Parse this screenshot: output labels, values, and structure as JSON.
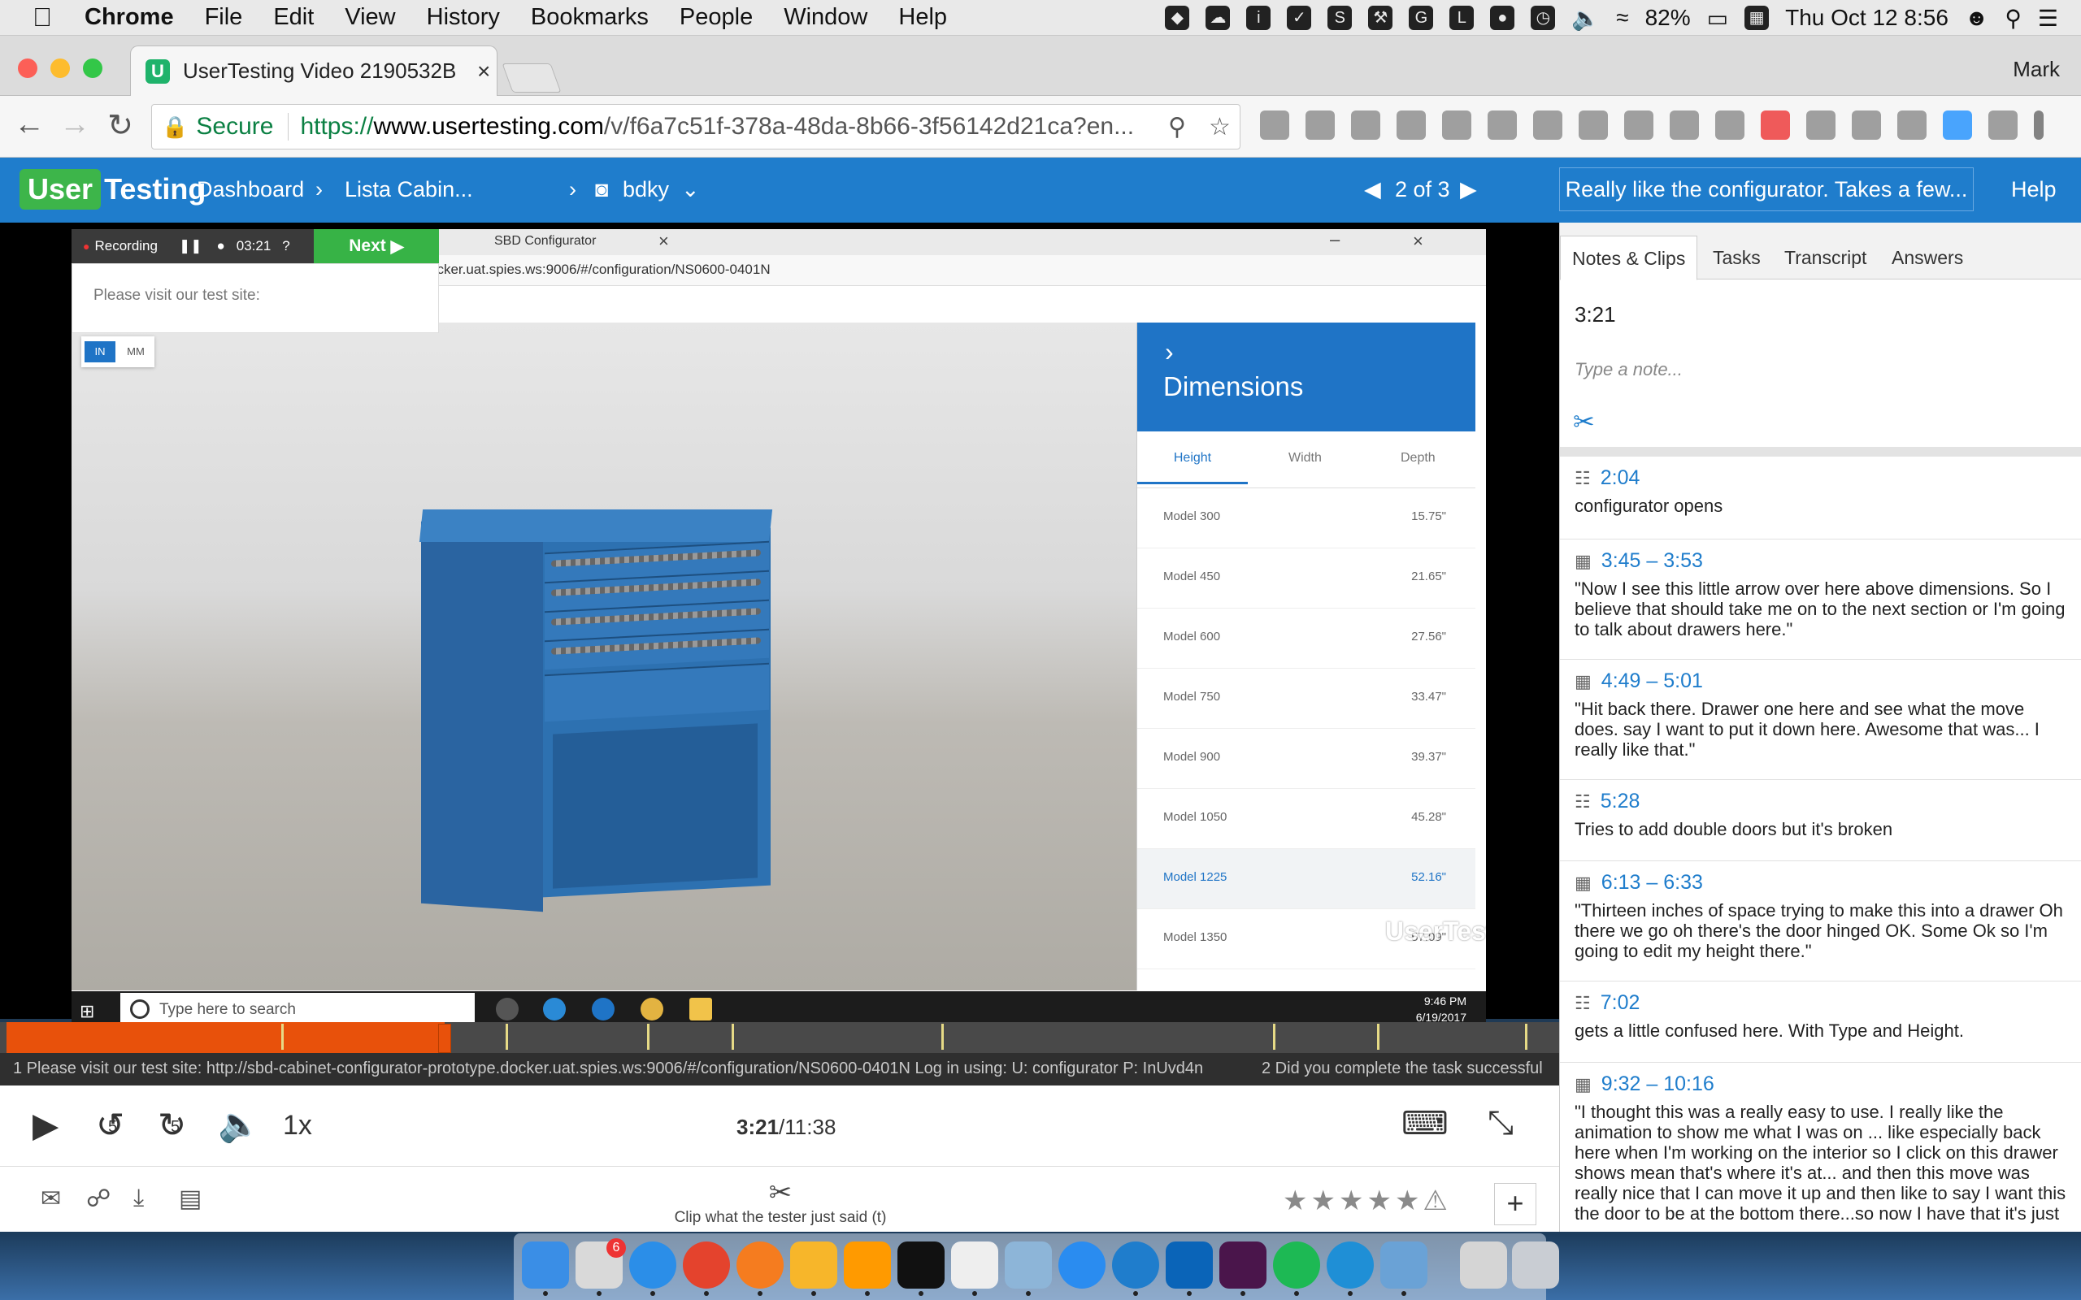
{
  "menubar": {
    "items": [
      "Chrome",
      "File",
      "Edit",
      "View",
      "History",
      "Bookmarks",
      "People",
      "Window",
      "Help"
    ],
    "battery": "82%",
    "clock": "Thu Oct 12  8:56"
  },
  "browser": {
    "tab_title": "UserTesting Video 2190532B",
    "user": "Mark",
    "secure_label": "Secure",
    "url_scheme": "https://",
    "url_host": "www.usertesting.com",
    "url_path": "/v/f6a7c51f-378a-48da-8b66-3f56142d21ca?en..."
  },
  "ut_header": {
    "logo_a": "User",
    "logo_b": "Testing",
    "dashboard": "Dashboard",
    "study": "Lista Cabin...",
    "tester": "bdky",
    "video_index": "2 of 3",
    "latest_note": "Really like the configurator. Takes a few...",
    "help": "Help"
  },
  "video": {
    "recording_label": "Recording",
    "rec_time": "03:21",
    "next_label": "Next",
    "inner_tab": "SBD Configurator",
    "inner_url": "ocker.uat.spies.ws:9006/#/configuration/NS0600-0401N",
    "visit_text": "Please visit our test site:",
    "unit_in": "IN",
    "unit_mm": "MM",
    "panel_title": "Dimensions",
    "panel_tabs": [
      "Height",
      "Width",
      "Depth"
    ],
    "models": [
      {
        "name": "Model 300",
        "value": "15.75\""
      },
      {
        "name": "Model 450",
        "value": "21.65\""
      },
      {
        "name": "Model 600",
        "value": "27.56\""
      },
      {
        "name": "Model 750",
        "value": "33.47\""
      },
      {
        "name": "Model 900",
        "value": "39.37\""
      },
      {
        "name": "Model 1050",
        "value": "45.28\""
      },
      {
        "name": "Model 1225",
        "value": "52.16\""
      },
      {
        "name": "Model 1350",
        "value": "57.09\""
      }
    ],
    "selected_model_index": 6,
    "watermark": "UserTesting",
    "win_search": "Type here to search",
    "win_time": "9:46 PM",
    "win_date": "6/19/2017"
  },
  "progress": {
    "played_fraction": 0.282,
    "task1": "1 Please visit our test site: http://sbd-cabinet-configurator-prototype.docker.uat.spies.ws:9006/#/configuration/NS0600-0401N  Log in using:  U: configurator P: InUvd4n",
    "task2": "2 Did you complete the task successful"
  },
  "controls": {
    "current_time": "3:21",
    "total_time": "/11:38",
    "speed": "1x",
    "rewind_label": "5",
    "forward_label": "5",
    "clip_label": "Clip what the tester just said (t)"
  },
  "sidebar": {
    "tabs": [
      "Notes & Clips",
      "Tasks",
      "Transcript",
      "Answers"
    ],
    "current_time": "3:21",
    "note_placeholder": "Type a note...",
    "notes": [
      {
        "kind": "note",
        "time": "2:04",
        "text": "configurator opens"
      },
      {
        "kind": "clip",
        "time": "3:45 – 3:53",
        "text": "\"Now I see this little arrow over here above dimensions. So I believe that should take me on to the next section or I'm going to talk about drawers here.\""
      },
      {
        "kind": "clip",
        "time": "4:49 – 5:01",
        "text": "\"Hit back there. Drawer one here and see what the move does. say I want to put it down here. Awesome that was... I really like that.\""
      },
      {
        "kind": "note",
        "time": "5:28",
        "text": "Tries to add double doors but it's broken"
      },
      {
        "kind": "clip",
        "time": "6:13 – 6:33",
        "text": "\"Thirteen inches of space trying to make this into a drawer Oh there we go oh there's the door hinged OK. Some Ok so I'm going to edit my height there.\""
      },
      {
        "kind": "note",
        "time": "7:02",
        "text": "gets a little confused here. With Type and Height."
      },
      {
        "kind": "clip",
        "time": "9:32 – 10:16",
        "text": "\"I thought this was a really easy to use. I really like the animation to show me what I was on ... like especially back here when I'm working on the interior so I click on this drawer shows mean that's where it's at... and then this move was really nice that I can move it up and then like to say I want this the door to be at the bottom there...so now I have that it's just"
      }
    ]
  },
  "dock": {
    "badge_mail": "6"
  },
  "colors": {
    "ut_blue": "#1f7dcc",
    "progress_orange": "#e8510b",
    "next_green": "#37b346"
  }
}
